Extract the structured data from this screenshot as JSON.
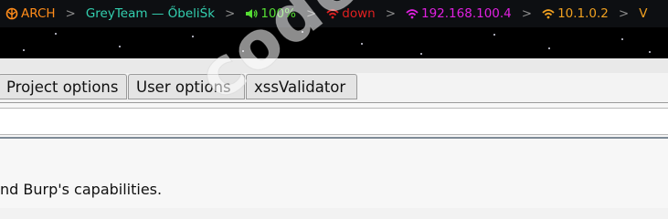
{
  "statusbar": {
    "segments": [
      {
        "name": "arch",
        "label": "ARCH",
        "icon": "rebel-icon",
        "color": "#ff8c1a"
      },
      {
        "name": "session",
        "label": "GreyTeam — ŐbeliŚk",
        "icon": "",
        "color": "#33d0b0"
      },
      {
        "name": "volume",
        "label": "100%",
        "icon": "speaker-icon",
        "color": "#55dd33"
      },
      {
        "name": "wifi-status",
        "label": "down",
        "icon": "wifi-icon",
        "color": "#e02020"
      },
      {
        "name": "ip-address",
        "label": "192.168.100.4",
        "icon": "wifi-icon",
        "color": "#e020e0"
      },
      {
        "name": "vpn-address",
        "label": "10.1.0.2",
        "icon": "wifi-icon",
        "color": "#f0a020"
      },
      {
        "name": "trailing",
        "label": "V",
        "icon": "",
        "color": "#f0a020"
      }
    ],
    "separator": ">"
  },
  "tabs": [
    {
      "name": "tab-project-options",
      "label": "Project options"
    },
    {
      "name": "tab-user-options",
      "label": "User options"
    },
    {
      "name": "tab-xssvalidator",
      "label": "xssValidator"
    }
  ],
  "description": "nd Burp's capabilities.",
  "watermark": "codeby.net"
}
